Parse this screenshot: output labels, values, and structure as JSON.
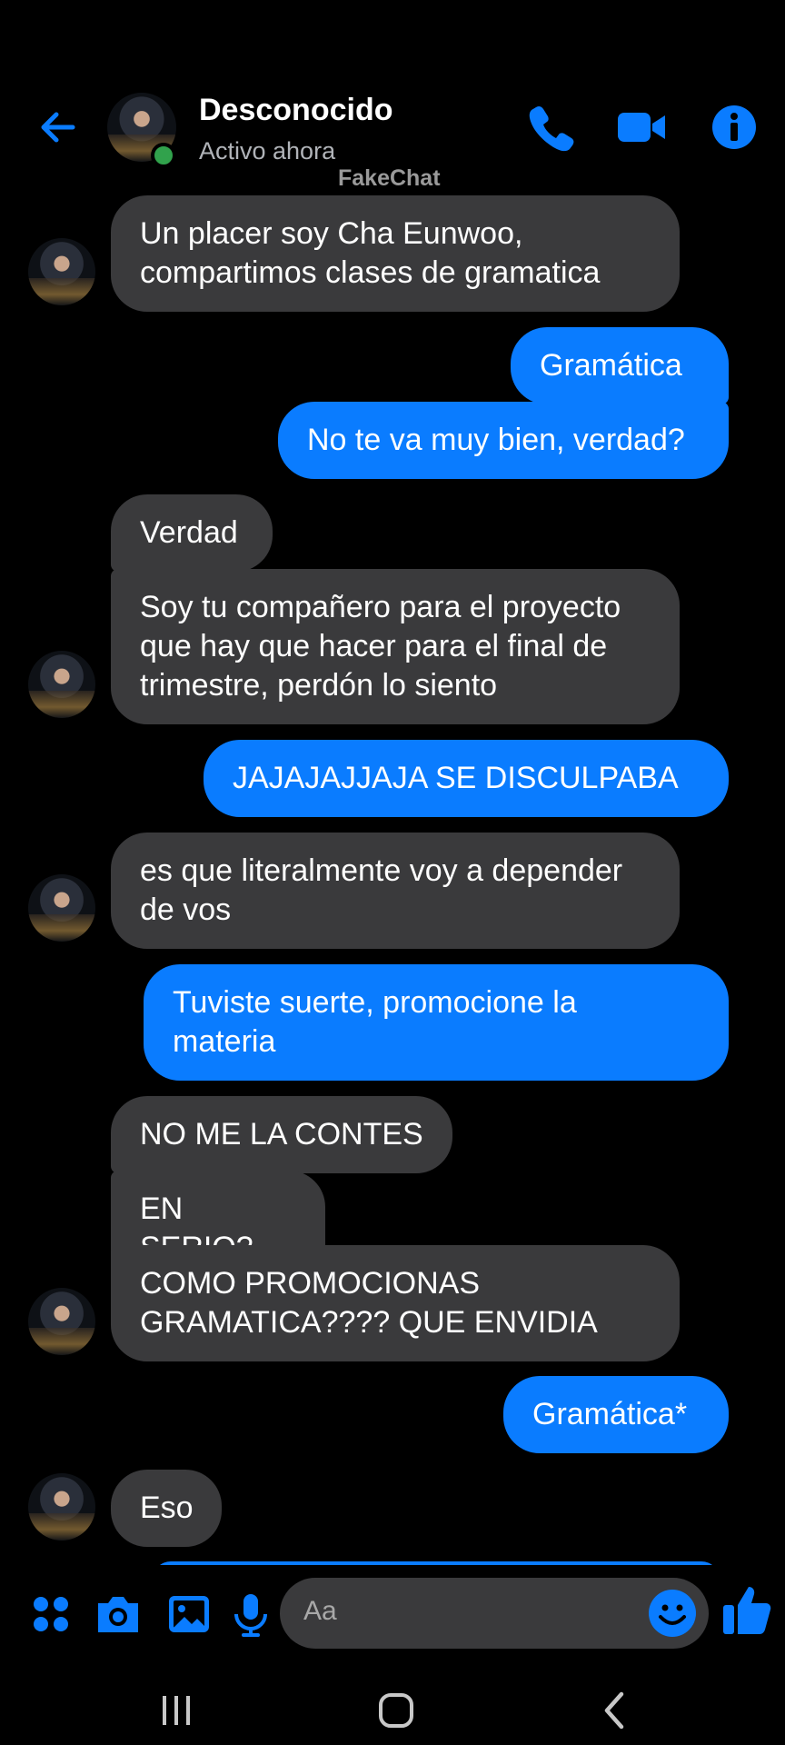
{
  "header": {
    "contact_name": "Desconocido",
    "status": "Activo ahora",
    "watermark": "FakeChat",
    "icons": [
      "back-arrow-icon",
      "phone-icon",
      "video-camera-icon",
      "info-icon"
    ]
  },
  "messages": [
    {
      "sender": "them",
      "text": "Un placer soy Cha Eunwoo,\ncompartimos clases de gramatica"
    },
    {
      "sender": "me",
      "text": "Gramática"
    },
    {
      "sender": "me",
      "text": "No te va muy bien, verdad?"
    },
    {
      "sender": "them",
      "text": "Verdad"
    },
    {
      "sender": "them",
      "text": "Soy tu compañero para el proyecto\nque hay que hacer para el final de\ntrimestre, perdón lo siento"
    },
    {
      "sender": "me",
      "text": "JAJAJAJJAJA SE DISCULPABA"
    },
    {
      "sender": "them",
      "text": "es que literalmente voy a depender\nde vos"
    },
    {
      "sender": "me",
      "text": "Tuviste suerte, promocione la\nmateria"
    },
    {
      "sender": "them",
      "text": "NO ME LA CONTES"
    },
    {
      "sender": "them",
      "text": "EN SERIO?"
    },
    {
      "sender": "them",
      "text": "COMO PROMOCIONAS\nGRAMATICA???? QUE ENVIDIA"
    },
    {
      "sender": "me",
      "text": "Gramática*"
    },
    {
      "sender": "them",
      "text": "Eso"
    }
  ],
  "composer": {
    "placeholder": "Aa",
    "icons": [
      "apps-icon",
      "camera-icon",
      "gallery-icon",
      "microphone-icon",
      "emoji-icon",
      "thumbs-up-icon"
    ]
  },
  "colors": {
    "background": "#000000",
    "incoming_bubble": "#3a3a3c",
    "outgoing_bubble": "#0a7cff",
    "accent": "#0a7cff",
    "online": "#31a24c"
  }
}
